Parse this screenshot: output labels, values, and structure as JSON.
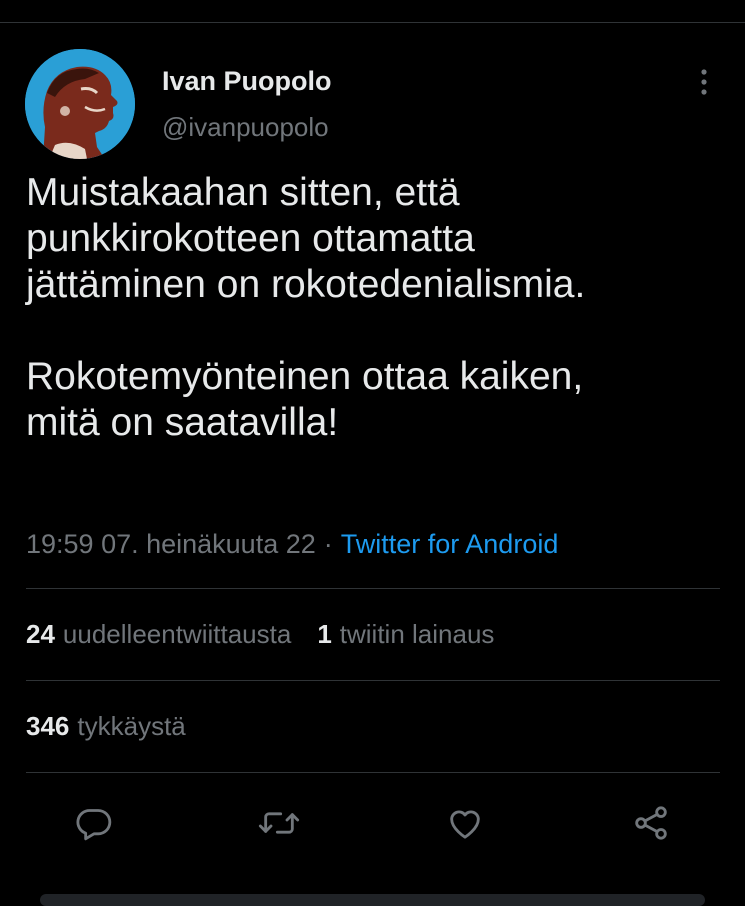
{
  "tweet": {
    "author": {
      "display_name": "Ivan Puopolo",
      "handle": "@ivanpuopolo"
    },
    "text": "Muistakaahan sitten, että\npunkkirokotteen ottamatta\njättäminen on rokotedenialismia.\n\nRokotemyönteinen ottaa kaiken,\nmitä on saatavilla!",
    "time": "19:59 07. heinäkuuta 22",
    "separator": "·",
    "source": "Twitter for Android"
  },
  "stats": {
    "retweets_count": "24",
    "retweets_label": "uudelleentwiittausta",
    "quotes_count": "1",
    "quotes_label": "twiitin lainaus",
    "likes_count": "346",
    "likes_label": "tykkäystä"
  },
  "icons": {
    "more": "more-vertical-icon",
    "reply": "reply-icon",
    "retweet": "retweet-icon",
    "like": "heart-icon",
    "share": "share-icon"
  },
  "colors": {
    "background": "#000000",
    "text_primary": "#e7e9ea",
    "text_secondary": "#71767b",
    "accent": "#1d9bf0",
    "avatar_bg": "#2a9fd6",
    "divider": "#2f3336"
  }
}
